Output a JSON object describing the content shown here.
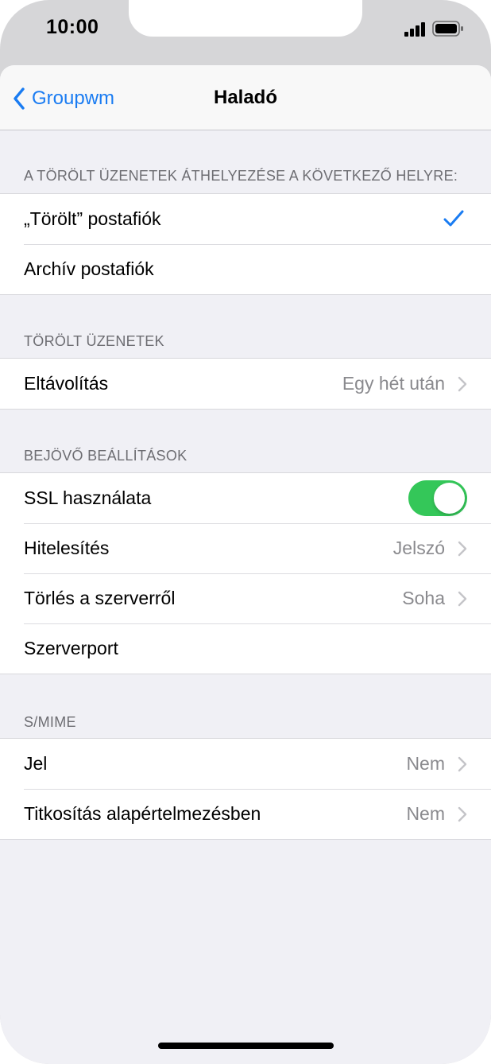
{
  "status_bar": {
    "time": "10:00"
  },
  "nav": {
    "back_label": "Groupwm",
    "title": "Haladó"
  },
  "sections": {
    "move_deleted": {
      "header": "A TÖRÖLT ÜZENETEK ÁTHELYEZÉSE A KÖVETKEZŐ HELYRE:",
      "rows": [
        {
          "label": "„Törölt” postafiók",
          "selected": true
        },
        {
          "label": "Archív postafiók",
          "selected": false
        }
      ]
    },
    "deleted_messages": {
      "header": "TÖRÖLT ÜZENETEK",
      "rows": [
        {
          "label": "Eltávolítás",
          "value": "Egy hét után"
        }
      ]
    },
    "incoming": {
      "header": "BEJÖVŐ BEÁLLÍTÁSOK",
      "rows": [
        {
          "label": "SSL használata",
          "toggle_on": true
        },
        {
          "label": "Hitelesítés",
          "value": "Jelszó"
        },
        {
          "label": "Törlés a szerverről",
          "value": "Soha"
        },
        {
          "label": "Szerverport"
        }
      ]
    },
    "smime": {
      "header": "S/MIME",
      "rows": [
        {
          "label": "Jel",
          "value": "Nem"
        },
        {
          "label": "Titkosítás alapértelmezésben",
          "value": "Nem"
        }
      ]
    }
  },
  "colors": {
    "accent": "#1a7cf2",
    "toggle_on": "#34c759",
    "background": "#f0f0f5"
  }
}
